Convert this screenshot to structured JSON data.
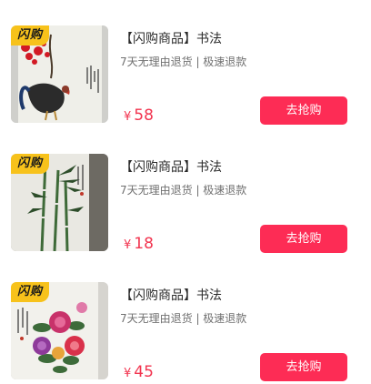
{
  "products": [
    {
      "badge": "闪购",
      "title": "【闪购商品】书法",
      "subtitle": "7天无理由退货 | 极速退款",
      "currency": "¥",
      "price": "58",
      "button": "去抢购",
      "image": "rooster-painting"
    },
    {
      "badge": "闪购",
      "title": "【闪购商品】书法",
      "subtitle": "7天无理由退货 | 极速退款",
      "currency": "¥",
      "price": "18",
      "button": "去抢购",
      "image": "bamboo-painting"
    },
    {
      "badge": "闪购",
      "title": "【闪购商品】书法",
      "subtitle": "7天无理由退货 | 极速退款",
      "currency": "¥",
      "price": "45",
      "button": "去抢购",
      "image": "peony-painting"
    }
  ],
  "colors": {
    "accent": "#fd2c55",
    "price": "#f2344f",
    "badge": "#f7c21b"
  }
}
